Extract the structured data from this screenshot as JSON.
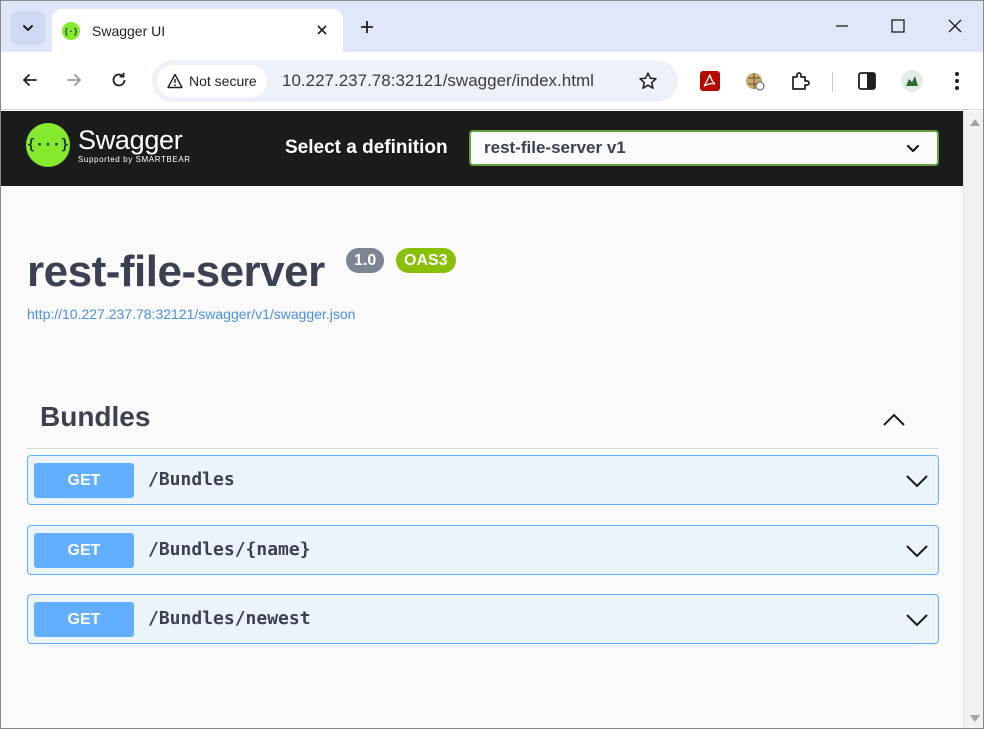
{
  "browser": {
    "tab": {
      "title": "Swagger UI"
    },
    "address": {
      "security_label": "Not secure",
      "url": "10.227.237.78:32121/swagger/index.html"
    }
  },
  "swagger": {
    "logo": {
      "name": "Swagger",
      "sub": "Supported by SMARTBEAR"
    },
    "definition_label": "Select a definition",
    "definition_selected": "rest-file-server v1",
    "api": {
      "title": "rest-file-server",
      "version": "1.0",
      "oas": "OAS3",
      "spec_url": "http://10.227.237.78:32121/swagger/v1/swagger.json"
    },
    "tag": {
      "name": "Bundles"
    },
    "operations": [
      {
        "method": "GET",
        "path": "/Bundles"
      },
      {
        "method": "GET",
        "path": "/Bundles/{name}"
      },
      {
        "method": "GET",
        "path": "/Bundles/newest"
      }
    ]
  },
  "colors": {
    "swagger_green": "#85ea2d",
    "get_blue": "#61affe",
    "topbar": "#1b1b1b",
    "oas_badge": "#89bf04",
    "version_badge": "#7d8492"
  },
  "icons": [
    "tab-search-icon",
    "swagger-favicon-icon",
    "close-icon",
    "new-tab-icon",
    "minimize-icon",
    "maximize-icon",
    "window-close-icon",
    "back-icon",
    "forward-icon",
    "reload-icon",
    "warning-icon",
    "star-icon",
    "pdf-extension-icon",
    "extension-icon",
    "puzzle-extensions-icon",
    "side-panel-icon",
    "profile-avatar-icon",
    "menu-icon",
    "chevron-down-icon",
    "chevron-up-icon"
  ]
}
